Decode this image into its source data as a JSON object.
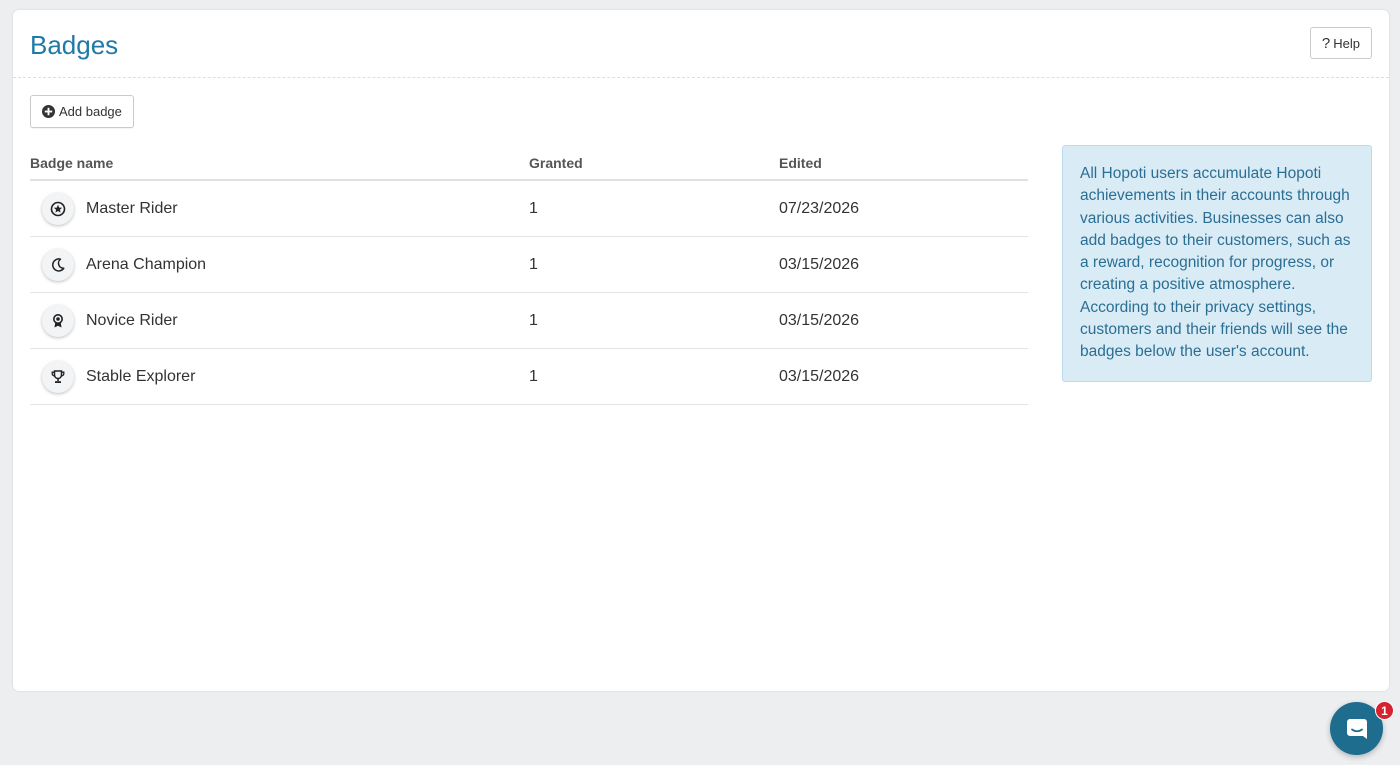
{
  "header": {
    "title": "Badges",
    "help_label": "Help"
  },
  "toolbar": {
    "add_badge_label": "Add badge"
  },
  "table": {
    "columns": [
      "Badge name",
      "Granted",
      "Edited"
    ],
    "rows": [
      {
        "name": "Master Rider",
        "granted": "1",
        "edited": "07/23/2026",
        "icon": "star-circle-icon"
      },
      {
        "name": "Arena Champion",
        "granted": "1",
        "edited": "03/15/2026",
        "icon": "moon-icon"
      },
      {
        "name": "Novice Rider",
        "granted": "1",
        "edited": "03/15/2026",
        "icon": "award-ribbon-icon"
      },
      {
        "name": "Stable Explorer",
        "granted": "1",
        "edited": "03/15/2026",
        "icon": "trophy-icon"
      }
    ]
  },
  "info": {
    "text": "All Hopoti users accumulate Hopoti achievements in their accounts through various activities. Businesses can also add badges to their customers, such as a reward, recognition for progress, or creating a positive atmosphere. According to their privacy settings, customers and their friends will see the badges below the user's account."
  },
  "chat": {
    "unread_count": "1"
  },
  "colors": {
    "title": "#1f7aa6",
    "info_bg": "#d9ecf6",
    "info_text": "#2b6e93",
    "chat_bg": "#1e6d8e",
    "badge_red": "#d7232f"
  }
}
